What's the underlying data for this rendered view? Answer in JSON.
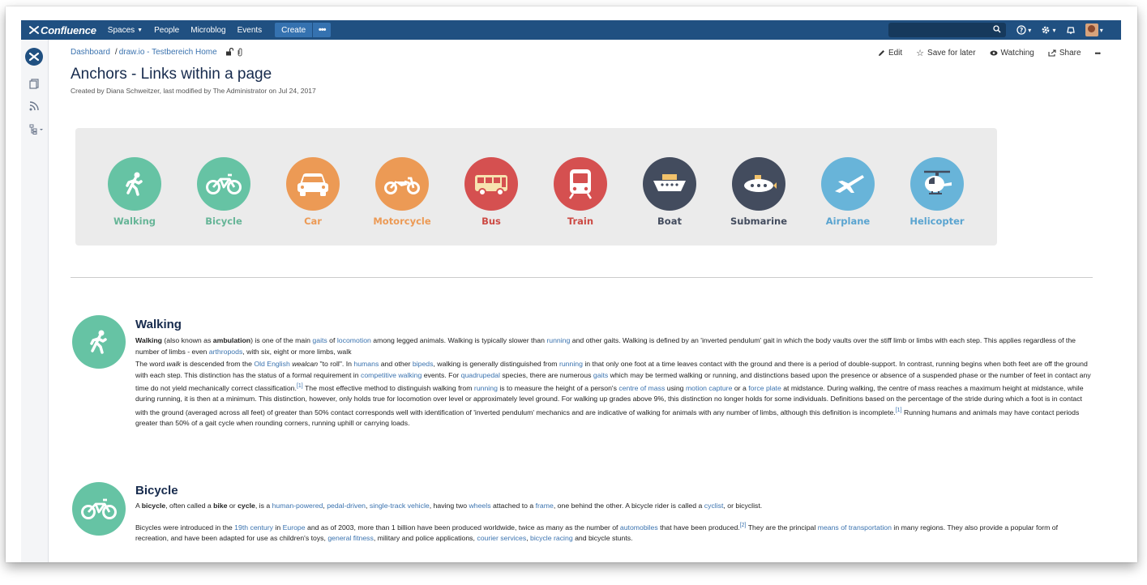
{
  "topnav": {
    "logo": "Confluence",
    "items": [
      {
        "label": "Spaces",
        "caret": true
      },
      {
        "label": "People",
        "caret": false
      },
      {
        "label": "Microblog",
        "caret": false
      },
      {
        "label": "Events",
        "caret": false
      }
    ],
    "create_label": "Create",
    "more_label": "•••",
    "brand_color": "#205081"
  },
  "breadcrumb": {
    "dashboard": "Dashboard",
    "sep": "/",
    "space": "draw.io - Testbereich Home"
  },
  "actions": {
    "edit": "Edit",
    "save": "Save for later",
    "watching": "Watching",
    "share": "Share",
    "more": "•••"
  },
  "page": {
    "title": "Anchors - Links within a page",
    "byline": "Created by Diana Schweitzer, last modified by The Administrator on Jul 24, 2017"
  },
  "transports": [
    {
      "label": "Walking",
      "icon": "walking-icon",
      "color": "#66c3a4",
      "text_color": "#66b597"
    },
    {
      "label": "Bicycle",
      "icon": "bicycle-icon",
      "color": "#66c3a4",
      "text_color": "#66b597"
    },
    {
      "label": "Car",
      "icon": "car-icon",
      "color": "#ec9a55",
      "text_color": "#ec9a55"
    },
    {
      "label": "Motorcycle",
      "icon": "motorcycle-icon",
      "color": "#ec9a55",
      "text_color": "#ec9a55"
    },
    {
      "label": "Bus",
      "icon": "bus-icon",
      "color": "#d55050",
      "text_color": "#cc4a44"
    },
    {
      "label": "Train",
      "icon": "train-icon",
      "color": "#d55050",
      "text_color": "#cc4a44"
    },
    {
      "label": "Boat",
      "icon": "boat-icon",
      "color": "#434c5e",
      "text_color": "#434c5e"
    },
    {
      "label": "Submarine",
      "icon": "submarine-icon",
      "color": "#434c5e",
      "text_color": "#434c5e"
    },
    {
      "label": "Airplane",
      "icon": "airplane-icon",
      "color": "#68b4d9",
      "text_color": "#5aa4d0"
    },
    {
      "label": "Helicopter",
      "icon": "helicopter-icon",
      "color": "#68b4d9",
      "text_color": "#5aa4d0"
    }
  ],
  "walking": {
    "title": "Walking",
    "p1": [
      {
        "t": "Walking",
        "b": true
      },
      {
        "t": " (also known as "
      },
      {
        "t": "ambulation",
        "b": true
      },
      {
        "t": ") is one of the main "
      },
      {
        "t": "gaits",
        "l": true
      },
      {
        "t": " of "
      },
      {
        "t": "locomotion",
        "l": true
      },
      {
        "t": " among legged animals. Walking is typically slower than "
      },
      {
        "t": "running",
        "l": true
      },
      {
        "t": " and other gaits. Walking is defined by an 'inverted pendulum' gait in which the body vaults over the stiff limb or limbs with each step. This applies regardless of the number of limbs - even "
      },
      {
        "t": "arthropods",
        "l": true
      },
      {
        "t": ", with six, eight or more limbs, walk"
      }
    ],
    "p2": [
      {
        "t": "The word "
      },
      {
        "t": "walk",
        "i": true
      },
      {
        "t": " is descended from the "
      },
      {
        "t": "Old English",
        "l": true
      },
      {
        "t": " "
      },
      {
        "t": "wealcan",
        "i": true
      },
      {
        "t": " \"to roll\". In "
      },
      {
        "t": "humans",
        "l": true
      },
      {
        "t": " and other "
      },
      {
        "t": "bipeds",
        "l": true
      },
      {
        "t": ", walking is generally distinguished from "
      },
      {
        "t": "running",
        "l": true
      },
      {
        "t": " in that only one foot at a time leaves contact with the ground and there is a period of double-support. In contrast, running begins when both feet are off the ground with each step. This distinction has the status of a formal requirement in "
      },
      {
        "t": "competitive walking",
        "l": true
      },
      {
        "t": " events. For "
      },
      {
        "t": "quadrupedal",
        "l": true
      },
      {
        "t": " species, there are numerous "
      },
      {
        "t": "gaits",
        "l": true
      },
      {
        "t": " which may be termed walking or running, and distinctions based upon the presence or absence of a suspended phase or the number of feet in contact any time do not yield mechanically correct classification."
      },
      {
        "t": "[1]",
        "s": true
      },
      {
        "t": " The most effective method to distinguish walking from "
      },
      {
        "t": "running",
        "l": true
      },
      {
        "t": " is to measure the height of a person's "
      },
      {
        "t": "centre of mass",
        "l": true
      },
      {
        "t": " using "
      },
      {
        "t": "motion capture",
        "l": true
      },
      {
        "t": " or a "
      },
      {
        "t": "force plate",
        "l": true
      },
      {
        "t": " at midstance. During walking, the centre of mass reaches a maximum height at midstance, while during running, it is then at a minimum. This distinction, however, only holds true for locomotion over level or approximately level ground. For walking up grades above 9%, this distinction no longer holds for some individuals. Definitions based on the percentage of the stride during which a foot is in contact with the ground (averaged across all feet) of greater than 50% contact corresponds well with identification of 'inverted pendulum' mechanics and are indicative of walking for animals with any number of limbs, although this definition is incomplete."
      },
      {
        "t": "[1]",
        "s": true
      },
      {
        "t": " Running humans and animals may have contact periods greater than 50% of a gait cycle when rounding corners, running uphill or carrying loads."
      }
    ]
  },
  "bicycle": {
    "title": "Bicycle",
    "p1": [
      {
        "t": "A "
      },
      {
        "t": "bicycle",
        "b": true
      },
      {
        "t": ", often called a "
      },
      {
        "t": "bike",
        "b": true
      },
      {
        "t": " or "
      },
      {
        "t": "cycle",
        "b": true
      },
      {
        "t": ", is a "
      },
      {
        "t": "human-powered",
        "l": true
      },
      {
        "t": ", "
      },
      {
        "t": "pedal-driven",
        "l": true
      },
      {
        "t": ", "
      },
      {
        "t": "single-track vehicle",
        "l": true
      },
      {
        "t": ", having two "
      },
      {
        "t": "wheels",
        "l": true
      },
      {
        "t": " attached to a "
      },
      {
        "t": "frame",
        "l": true
      },
      {
        "t": ", one behind the other. A  bicycle rider is called a "
      },
      {
        "t": "cyclist",
        "l": true
      },
      {
        "t": ", or bicyclist."
      }
    ],
    "p2": [
      {
        "t": "Bicycles were introduced in the "
      },
      {
        "t": "19th century",
        "l": true
      },
      {
        "t": " in "
      },
      {
        "t": "Europe",
        "l": true
      },
      {
        "t": " and as of 2003, more than 1 billion have been produced worldwide, twice as many as the number of "
      },
      {
        "t": "automobiles",
        "l": true
      },
      {
        "t": " that have been produced."
      },
      {
        "t": "[2]",
        "s": true
      },
      {
        "t": " They are the principal "
      },
      {
        "t": "means of transportation",
        "l": true
      },
      {
        "t": " in many regions. They also provide a popular form of recreation, and have been adapted for use as children's toys, "
      },
      {
        "t": "general fitness",
        "l": true
      },
      {
        "t": ", military and police applications, "
      },
      {
        "t": "courier services",
        "l": true
      },
      {
        "t": ", "
      },
      {
        "t": "bicycle racing",
        "l": true
      },
      {
        "t": " and bicycle stunts."
      }
    ]
  }
}
